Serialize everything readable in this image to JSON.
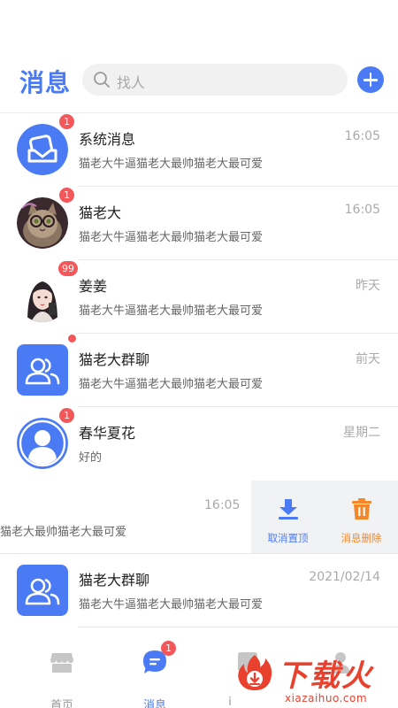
{
  "header": {
    "title": "消息",
    "search_placeholder": "找人"
  },
  "conversations": [
    {
      "name": "系统消息",
      "time": "16:05",
      "preview": "猫老大牛逼猫老大最帅猫老大最可爱",
      "badge": "1",
      "avatar": "system-message-icon"
    },
    {
      "name": "猫老大",
      "time": "16:05",
      "preview": "猫老大牛逼猫老大最帅猫老大最可爱",
      "badge": "1",
      "avatar": "cat-photo"
    },
    {
      "name": "姜姜",
      "time": "昨天",
      "preview": "猫老大牛逼猫老大最帅猫老大最可爱",
      "badge": "99",
      "avatar": "girl-portrait"
    },
    {
      "name": "猫老大群聊",
      "time": "前天",
      "preview": "猫老大牛逼猫老大最帅猫老大最可爱",
      "badge_dot": true,
      "avatar": "group-icon"
    },
    {
      "name": "春华夏花",
      "time": "星期二",
      "preview": "好的",
      "badge": "1",
      "avatar": "user-icon"
    },
    {
      "time": "16:05",
      "preview": "猫老大最帅猫老大最可爱",
      "swiped": true
    },
    {
      "name": "猫老大群聊",
      "time": "2021/02/14",
      "preview": "猫老大牛逼猫老大最帅猫老大最可爱",
      "avatar": "group-icon"
    }
  ],
  "swipe_actions": {
    "unpin": "取消置顶",
    "delete": "消息删除"
  },
  "tabbar": {
    "home": "首页",
    "messages": "消息",
    "messages_badge": "1",
    "third_partial": "i"
  },
  "watermark": {
    "text": "下载火",
    "url": "xiazaihuo.com"
  },
  "colors": {
    "accent": "#4b7bf4",
    "badge": "#f4575a",
    "delete": "#f3872a",
    "watermark": "#e8412e"
  }
}
